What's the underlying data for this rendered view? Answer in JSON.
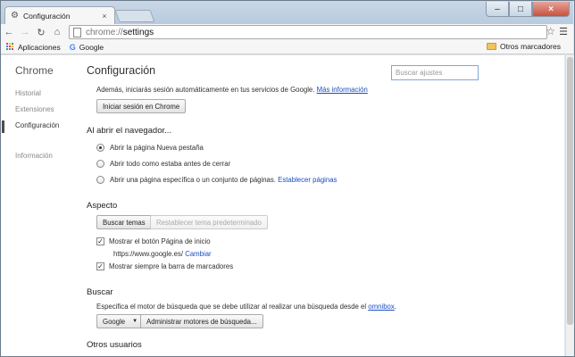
{
  "browser": {
    "tab_title": "Configuración",
    "tab_close": "×",
    "url_scheme": "chrome://",
    "url_host": "settings",
    "window_controls": [
      "–",
      "□",
      "×"
    ]
  },
  "bookmarks": {
    "apps_label": "Aplicaciones",
    "google_label": "Google",
    "other_label": "Otros marcadores"
  },
  "sidebar": {
    "title": "Chrome",
    "items": [
      "Historial",
      "Extensiones",
      "Configuración",
      "Información"
    ],
    "active_index": 2
  },
  "main": {
    "title": "Configuración",
    "search_placeholder": "Buscar ajustes",
    "signin": {
      "text": "Además, iniciarás sesión automáticamente en tus servicios de Google.",
      "link": "Más información",
      "button": "Iniciar sesión en Chrome"
    },
    "startup": {
      "heading": "Al abrir el navegador...",
      "options": [
        "Abrir la página Nueva pestaña",
        "Abrir todo como estaba antes de cerrar",
        "Abrir una página específica o un conjunto de páginas."
      ],
      "options_link": "Establecer páginas",
      "selected_index": 0
    },
    "appearance": {
      "heading": "Aspecto",
      "themes_button": "Buscar temas",
      "reset_button": "Restablecer tema predeterminado",
      "home_button_label": "Mostrar el botón Página de inicio",
      "home_button_checked": true,
      "home_url": "https://www.google.es/",
      "change_link": "Cambiar",
      "bookmarks_bar_label": "Mostrar siempre la barra de marcadores",
      "bookmarks_bar_checked": true
    },
    "search": {
      "heading": "Buscar",
      "text": "Especifica el motor de búsqueda que se debe utilizar al realizar una búsqueda desde el",
      "link": "omnibox",
      "text_end": ".",
      "engine": "Google",
      "manage_button": "Administrar motores de búsqueda..."
    },
    "users": {
      "heading": "Otros usuarios"
    }
  },
  "colors": {
    "link": "#1a4ec2",
    "close_button": "#c8523e",
    "search_focus_border": "#7fa7d8"
  }
}
